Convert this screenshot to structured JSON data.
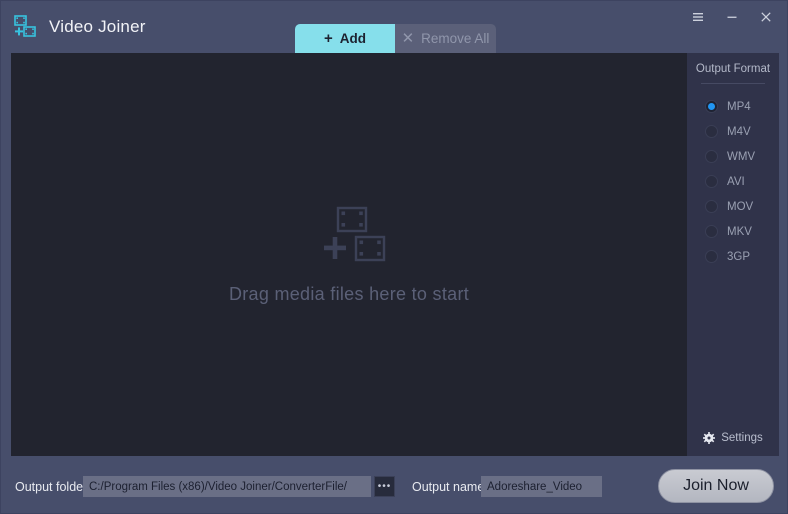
{
  "window": {
    "title": "Video Joiner",
    "logo_icon": "video-joiner-logo-icon",
    "controls": {
      "menu": "menu-icon",
      "minimize": "minimize-icon",
      "close": "close-icon"
    }
  },
  "toolbar": {
    "add_label": "Add",
    "add_glyph": "+",
    "remove_label": "Remove All",
    "remove_glyph": "✕"
  },
  "dropzone": {
    "icon": "add-media-filmstrip-icon",
    "message": "Drag media files here to start"
  },
  "output_format": {
    "title": "Output Format",
    "selected": "MP4",
    "options": [
      {
        "label": "MP4",
        "selected": true
      },
      {
        "label": "M4V",
        "selected": false
      },
      {
        "label": "WMV",
        "selected": false
      },
      {
        "label": "AVI",
        "selected": false
      },
      {
        "label": "MOV",
        "selected": false
      },
      {
        "label": "MKV",
        "selected": false
      },
      {
        "label": "3GP",
        "selected": false
      }
    ],
    "settings_label": "Settings",
    "settings_icon": "gear-icon"
  },
  "footer": {
    "folder_label": "Output folder:",
    "folder_value": "C:/Program Files (x86)/Video Joiner/ConverterFile/",
    "browse_label": "•••",
    "name_label": "Output name:",
    "name_value": "Adoreshare_Video",
    "join_label": "Join Now"
  },
  "colors": {
    "frame": "#474e6b",
    "content": "#22242f",
    "panel": "#30334a",
    "accent_cyan": "#86dfeb",
    "accent_blue": "#2196f3",
    "logo_cyan": "#37c3e0"
  }
}
